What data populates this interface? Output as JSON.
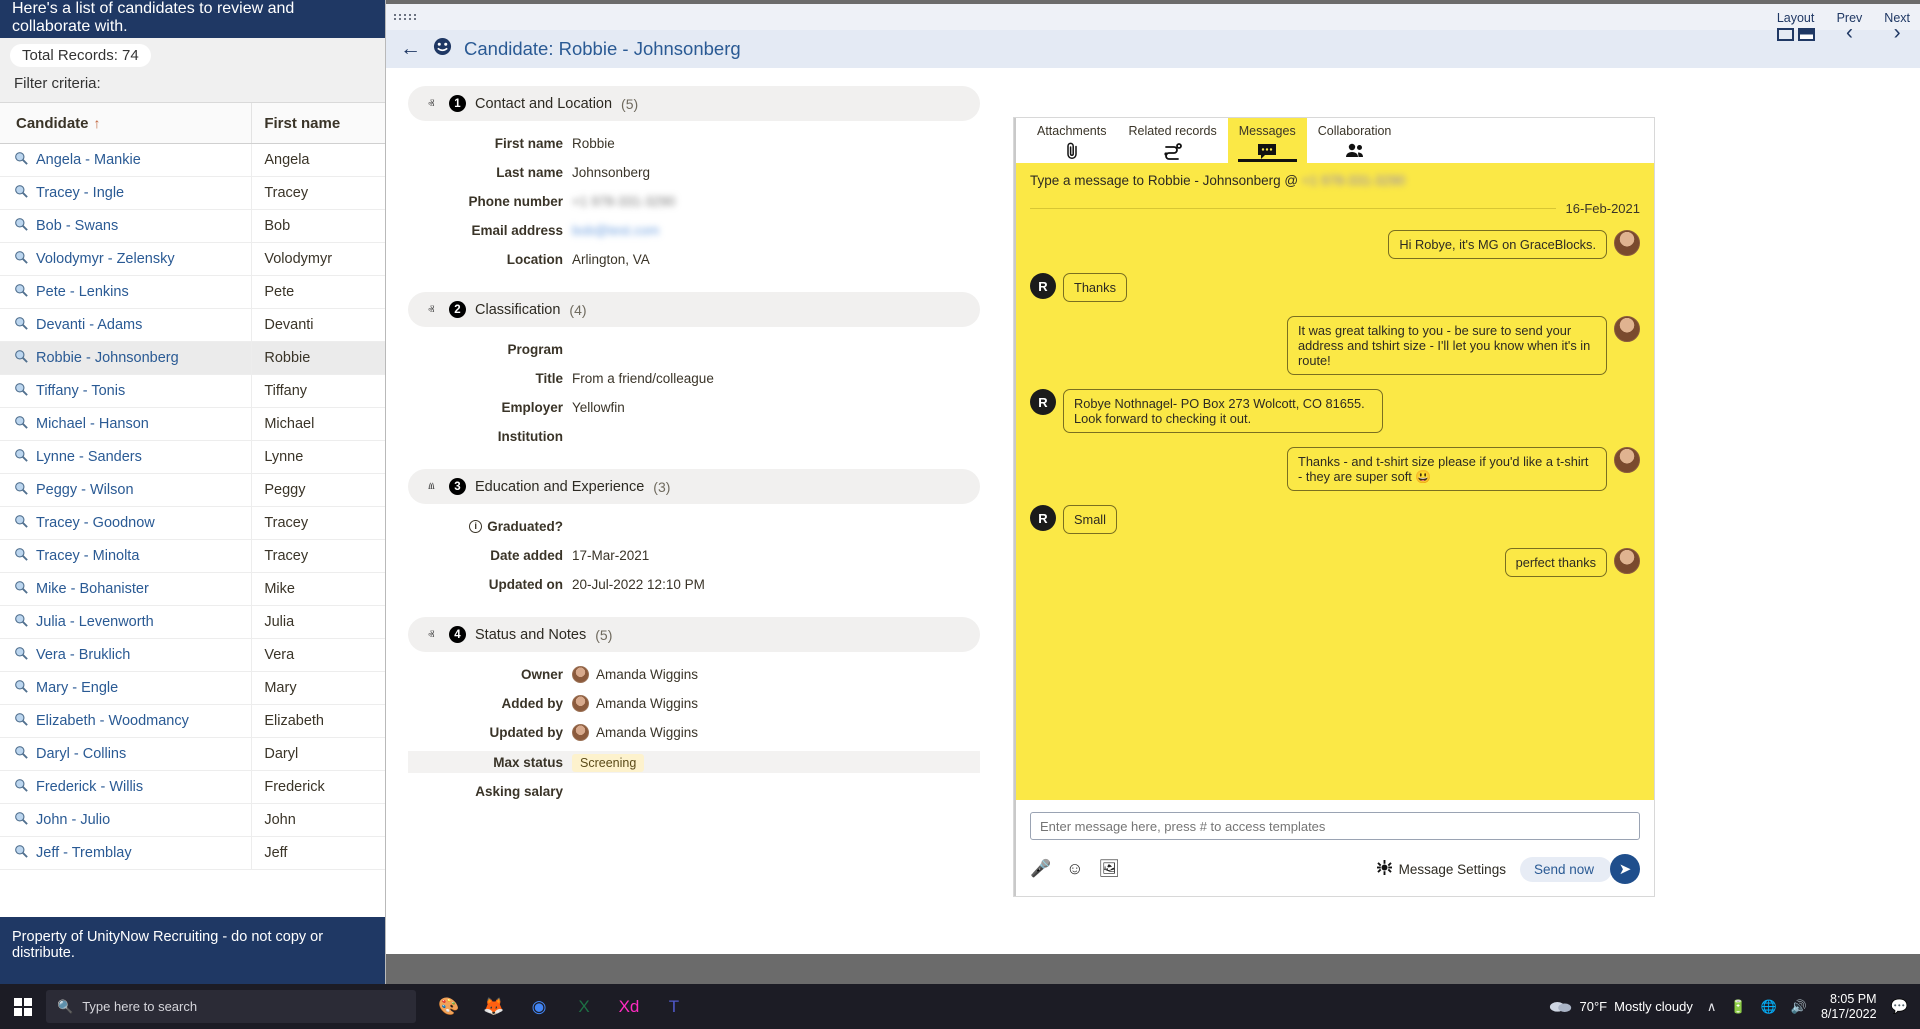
{
  "left_panel": {
    "banner": "Here's a list of candidates to review and collaborate with.",
    "total_records": "Total Records: 74",
    "filter_criteria": "Filter criteria:",
    "columns": [
      "Candidate",
      "First name"
    ],
    "sort_arrow": "↑",
    "rows": [
      {
        "candidate": "Angela - Mankie",
        "first": "Angela"
      },
      {
        "candidate": "Tracey - Ingle",
        "first": "Tracey"
      },
      {
        "candidate": "Bob - Swans",
        "first": "Bob"
      },
      {
        "candidate": "Volodymyr - Zelensky",
        "first": "Volodymyr"
      },
      {
        "candidate": "Pete - Lenkins",
        "first": "Pete"
      },
      {
        "candidate": "Devanti - Adams",
        "first": "Devanti"
      },
      {
        "candidate": "Robbie - Johnsonberg",
        "first": "Robbie"
      },
      {
        "candidate": "Tiffany - Tonis",
        "first": "Tiffany"
      },
      {
        "candidate": "Michael - Hanson",
        "first": "Michael"
      },
      {
        "candidate": "Lynne - Sanders",
        "first": "Lynne"
      },
      {
        "candidate": "Peggy - Wilson",
        "first": "Peggy"
      },
      {
        "candidate": "Tracey - Goodnow",
        "first": "Tracey"
      },
      {
        "candidate": "Tracey - Minolta",
        "first": "Tracey"
      },
      {
        "candidate": "Mike - Bohanister",
        "first": "Mike"
      },
      {
        "candidate": "Julia - Levenworth",
        "first": "Julia"
      },
      {
        "candidate": "Vera - Bruklich",
        "first": "Vera"
      },
      {
        "candidate": "Mary - Engle",
        "first": "Mary"
      },
      {
        "candidate": "Elizabeth - Woodmancy",
        "first": "Elizabeth"
      },
      {
        "candidate": "Daryl - Collins",
        "first": "Daryl"
      },
      {
        "candidate": "Frederick - Willis",
        "first": "Frederick"
      },
      {
        "candidate": "John - Julio",
        "first": "John"
      },
      {
        "candidate": "Jeff - Tremblay",
        "first": "Jeff"
      }
    ],
    "selected_index": 6,
    "footer": "Property of UnityNow Recruiting - do not copy or distribute."
  },
  "window_bar": {
    "layout_label": "Layout",
    "prev_label": "Prev",
    "next_label": "Next",
    "prev_arrow": "‹",
    "next_arrow": "›"
  },
  "record": {
    "back_arrow": "←",
    "title": "Candidate: Robbie - Johnsonberg"
  },
  "sections": [
    {
      "num": "1",
      "title": "Contact and Location",
      "count": "(5)",
      "chevron": "ⱏ",
      "fields": [
        {
          "label": "First name",
          "value": "Robbie",
          "style": "plain"
        },
        {
          "label": "Last name",
          "value": "Johnsonberg",
          "style": "plain"
        },
        {
          "label": "Phone number",
          "value": "+1 978-331-3290",
          "style": "blur"
        },
        {
          "label": "Email address",
          "value": "bob@test.com",
          "style": "blur-link"
        },
        {
          "label": "Location",
          "value": "Arlington, VA",
          "style": "plain"
        }
      ]
    },
    {
      "num": "2",
      "title": "Classification",
      "count": "(4)",
      "chevron": "ⱏ",
      "fields": [
        {
          "label": "Program",
          "value": "",
          "style": "plain"
        },
        {
          "label": "Title",
          "value": "From a friend/colleague",
          "style": "plain"
        },
        {
          "label": "Employer",
          "value": "Yellowfin",
          "style": "plain"
        },
        {
          "label": "Institution",
          "value": "",
          "style": "plain"
        }
      ]
    },
    {
      "num": "3",
      "title": "Education and Experience",
      "count": "(3)",
      "chevron": "ⱞ",
      "fields": [
        {
          "label": "Graduated?",
          "value": "",
          "style": "info"
        },
        {
          "label": "Date added",
          "value": "17-Mar-2021",
          "style": "plain"
        },
        {
          "label": "Updated on",
          "value": "20-Jul-2022 12:10 PM",
          "style": "plain"
        }
      ]
    },
    {
      "num": "4",
      "title": "Status and Notes",
      "count": "(5)",
      "chevron": "ⱏ",
      "fields": [
        {
          "label": "Owner",
          "value": "Amanda Wiggins",
          "style": "avatar"
        },
        {
          "label": "Added by",
          "value": "Amanda Wiggins",
          "style": "avatar"
        },
        {
          "label": "Updated by",
          "value": "Amanda Wiggins",
          "style": "avatar"
        },
        {
          "label": "Max status",
          "value": "Screening",
          "style": "tag"
        },
        {
          "label": "Asking salary",
          "value": "",
          "style": "plain"
        }
      ]
    }
  ],
  "messages_panel": {
    "tabs": [
      {
        "label": "Attachments",
        "icon": "paperclip-icon",
        "glyph": "📎",
        "active": false
      },
      {
        "label": "Related records",
        "icon": "shuffle-icon",
        "glyph": "⤳",
        "active": false
      },
      {
        "label": "Messages",
        "icon": "chat-bubble-icon",
        "glyph": "💬",
        "active": true
      },
      {
        "label": "Collaboration",
        "icon": "people-icon",
        "glyph": "👥",
        "active": false
      }
    ],
    "compose_hint_prefix": "Type a message to Robbie - Johnsonberg @",
    "compose_hint_redacted": "+1 978-331-3290",
    "date_divider": "16-Feb-2021",
    "bubbles": [
      {
        "dir": "out",
        "text": "Hi Robye, it's MG on GraceBlocks.",
        "avatar": "photo"
      },
      {
        "dir": "in",
        "text": "Thanks",
        "avatar": "R"
      },
      {
        "dir": "out",
        "text": "It was great talking to you - be sure to send your address and tshirt size - I'll let you know when it's in route!",
        "avatar": "photo"
      },
      {
        "dir": "in",
        "text": "Robye Nothnagel- PO Box 273 Wolcott, CO 81655. Look forward to checking it out.",
        "avatar": "R"
      },
      {
        "dir": "out",
        "text": "Thanks - and t-shirt size please if you'd like a t-shirt - they are super soft 😃",
        "avatar": "photo"
      },
      {
        "dir": "in",
        "text": "Small",
        "avatar": "R"
      },
      {
        "dir": "out",
        "text": "perfect thanks",
        "avatar": "photo"
      }
    ],
    "composer": {
      "placeholder": "Enter message here, press # to access templates",
      "value": "",
      "mic_icon": "🎤",
      "emoji_icon": "☺",
      "image_icon": "🖼",
      "settings_label": "Message Settings",
      "send_now_label": "Send now",
      "send_glyph": "➤"
    }
  },
  "taskbar": {
    "search_placeholder": "Type here to search",
    "search_icon": "🔍",
    "apps": [
      {
        "name": "paint-3d-icon",
        "glyph": "🎨",
        "color": "#d87fb5"
      },
      {
        "name": "firefox-icon",
        "glyph": "🦊",
        "color": "#ff7139"
      },
      {
        "name": "chrome-icon",
        "glyph": "◉",
        "color": "#4285f4"
      },
      {
        "name": "excel-icon",
        "glyph": "X",
        "color": "#1d7044"
      },
      {
        "name": "xd-icon",
        "glyph": "Xd",
        "color": "#ff2bc2"
      },
      {
        "name": "teams-icon",
        "glyph": "T",
        "color": "#5059c9"
      }
    ],
    "weather_temp": "70°F",
    "weather_desc": "Mostly cloudy",
    "time": "8:05 PM",
    "date": "8/17/2022",
    "tray_icons": [
      "∧",
      "🔋",
      "🌐",
      "🔊"
    ],
    "notification_icon": "💬"
  }
}
